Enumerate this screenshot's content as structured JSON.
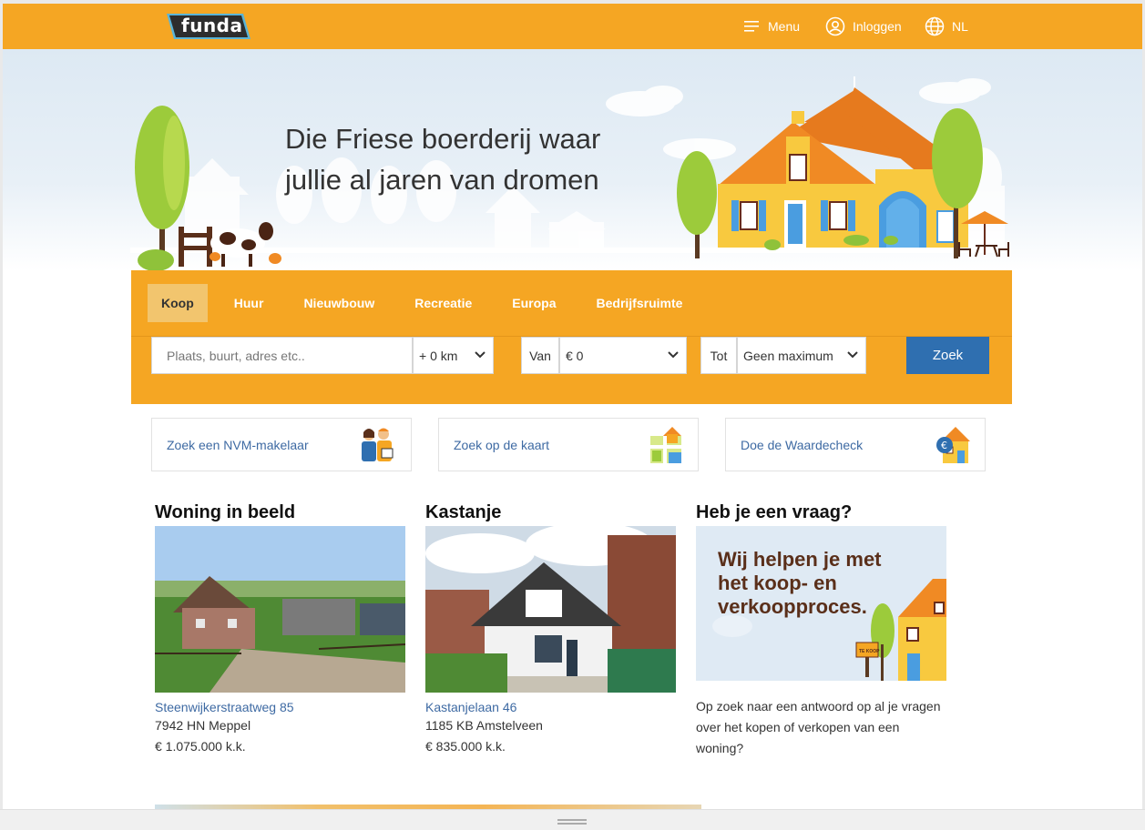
{
  "header": {
    "logo_text": "funda",
    "menu_label": "Menu",
    "login_label": "Inloggen",
    "language_label": "NL",
    "brand_color": "#f5a623"
  },
  "hero": {
    "title_line1": "Die Friese boerderij waar",
    "title_line2": "jullie al jaren van dromen"
  },
  "search": {
    "tabs": [
      {
        "label": "Koop",
        "active": true
      },
      {
        "label": "Huur",
        "active": false
      },
      {
        "label": "Nieuwbouw",
        "active": false
      },
      {
        "label": "Recreatie",
        "active": false
      },
      {
        "label": "Europa",
        "active": false
      },
      {
        "label": "Bedrijfsruimte",
        "active": false
      }
    ],
    "place_placeholder": "Plaats, buurt, adres etc..",
    "radius_value": "+ 0 km",
    "from_label": "Van",
    "from_value": "€ 0",
    "to_label": "Tot",
    "to_value": "Geen maximum",
    "submit_label": "Zoek"
  },
  "quick_links": [
    {
      "label": "Zoek een NVM-makelaar",
      "icon": "agents-icon"
    },
    {
      "label": "Zoek op de kaart",
      "icon": "map-icon"
    },
    {
      "label": "Doe de Waardecheck",
      "icon": "house-value-icon"
    }
  ],
  "cards": [
    {
      "heading": "Woning in beeld",
      "address": "Steenwijkerstraatweg 85",
      "city": "7942 HN Meppel",
      "price": "€ 1.075.000 k.k."
    },
    {
      "heading": "Kastanje",
      "address": "Kastanjelaan 46",
      "city": "1185 KB Amstelveen",
      "price": "€ 835.000 k.k."
    },
    {
      "heading": "Heb je een vraag?",
      "banner_text_line1": "Wij helpen je met",
      "banner_text_line2": "het koop- en",
      "banner_text_line3": "verkoopproces.",
      "banner_sign": "TE KOOP",
      "description": "Op zoek naar een antwoord op al je vragen over het kopen of verkopen van een woning?"
    }
  ]
}
